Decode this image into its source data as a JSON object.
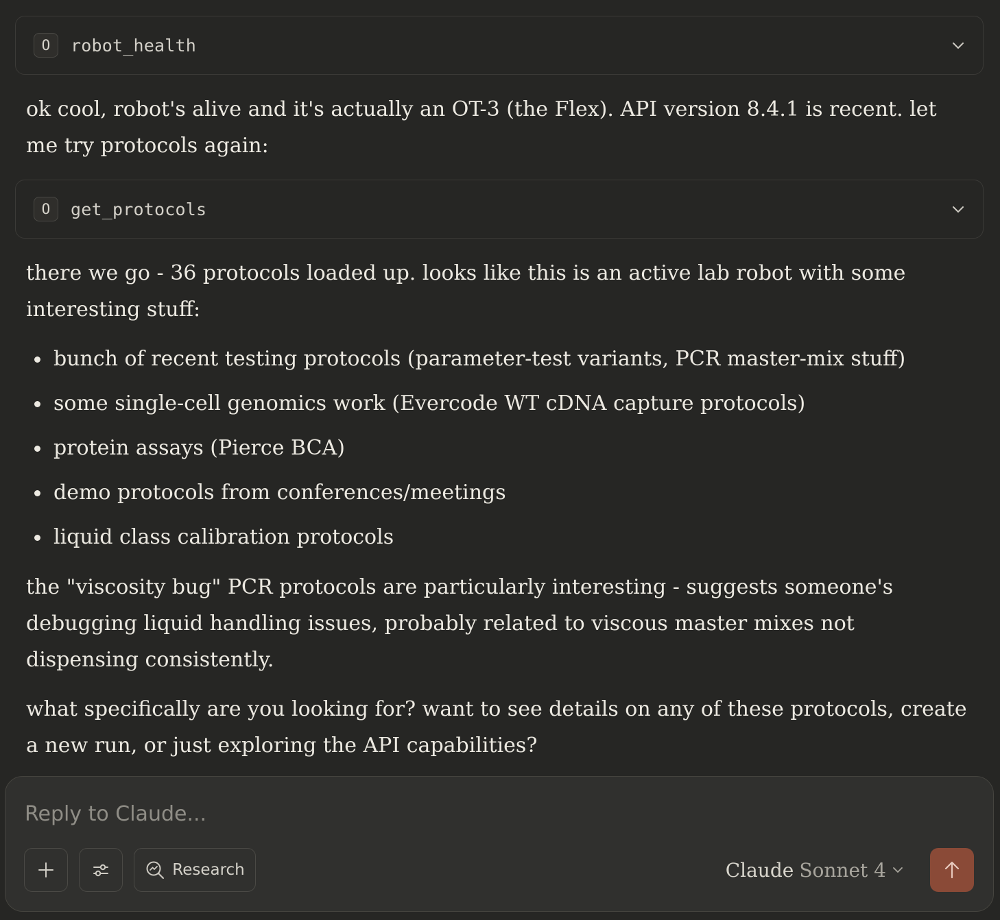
{
  "tool_calls": [
    {
      "badge": "O",
      "name": "robot_health"
    },
    {
      "badge": "O",
      "name": "get_protocols"
    }
  ],
  "message": {
    "p1": "ok cool, robot's alive and it's actually an OT-3 (the Flex). API version 8.4.1 is recent. let me try protocols again:",
    "p2": "there we go - 36 protocols loaded up. looks like this is an active lab robot with some interesting stuff:",
    "bullets": [
      "bunch of recent testing protocols (parameter-test variants, PCR master-mix stuff)",
      "some single-cell genomics work (Evercode WT cDNA capture protocols)",
      "protein assays (Pierce BCA)",
      "demo protocols from conferences/meetings",
      "liquid class calibration protocols"
    ],
    "p3": "the \"viscosity bug\" PCR protocols are particularly interesting - suggests someone's debugging liquid handling issues, probably related to viscous master mixes not dispensing consistently.",
    "p4": "what specifically are you looking for? want to see details on any of these protocols, create a new run, or just exploring the API capabilities?"
  },
  "composer": {
    "placeholder": "Reply to Claude...",
    "value": "",
    "research_label": "Research",
    "model_brand": "Claude",
    "model_name": "Sonnet 4"
  },
  "icons": {
    "add": "plus-icon",
    "tools": "sliders-icon",
    "research": "research-search-icon",
    "model_chevron": "chevron-down-icon",
    "send": "arrow-up-icon"
  },
  "colors": {
    "background": "#262624",
    "composer_bg": "#30302e",
    "send_accent": "#8a4a37",
    "text": "#ece9e1"
  }
}
